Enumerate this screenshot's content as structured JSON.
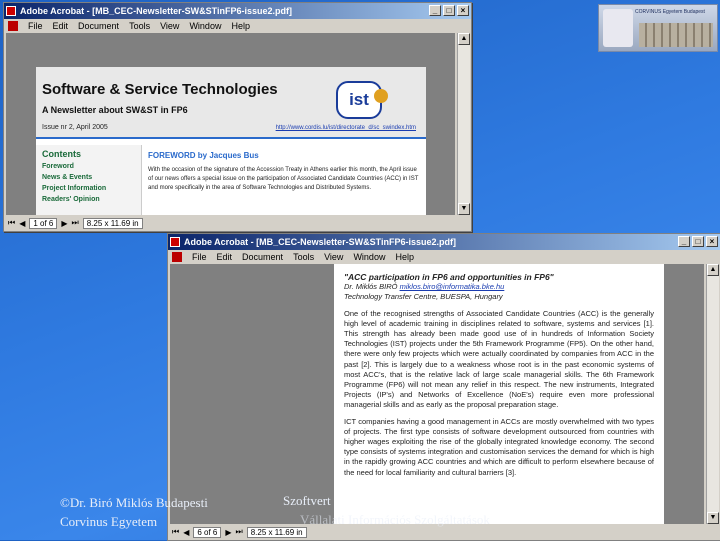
{
  "logo": {
    "text": "CORVINUS Egyetem Budapest",
    "alt": "Corvinus University Budapest logo with building"
  },
  "window1": {
    "title": "Adobe Acrobat - [MB_CEC-Newsletter-SW&STinFP6-issue2.pdf]",
    "menu": [
      "File",
      "Edit",
      "Document",
      "Tools",
      "View",
      "Window",
      "Help"
    ],
    "page_indicator": "1 of 6",
    "page_size": "8.25 x 11.69 in",
    "newsletter": {
      "title": "Software & Service Technologies",
      "subtitle": "A Newsletter about SW&ST in FP6",
      "issue": "Issue nr 2, April 2005",
      "url": "http://www.cordis.lu/ist/directorate_d/sc_swindex.htm",
      "logo_text": "ist",
      "contents_heading": "Contents",
      "contents_items": [
        "Foreword",
        "News & Events",
        "Project Information",
        "Readers' Opinion"
      ],
      "foreword_heading": "FOREWORD by Jacques Bus",
      "foreword_text": "With the occasion of the signature of the Accession Treaty in Athens earlier this month, the April issue of our news offers a special issue on the participation of Associated Candidate Countries (ACC) in IST and more specifically in the area of Software Technologies and Distributed Systems."
    }
  },
  "window2": {
    "title": "Adobe Acrobat - [MB_CEC-Newsletter-SW&STinFP6-issue2.pdf]",
    "menu": [
      "File",
      "Edit",
      "Document",
      "Tools",
      "View",
      "Window",
      "Help"
    ],
    "page_indicator": "6 of 6",
    "page_size": "8.25 x 11.69 in",
    "article": {
      "heading": "\"ACC participation in FP6 and opportunities in FP6\"",
      "author": "Dr. Miklós BIRÓ",
      "author_email": "miklos.biro@informatika.bke.hu",
      "org": "Technology Transfer Centre, BUESPA, Hungary",
      "para1": "One of the recognised strengths of Associated Candidate Countries (ACC) is the generally high level of academic training in disciplines related to software, systems and services [1]. This strength has already been made good use of in hundreds of Information Society Technologies (IST) projects under the 5th Framework Programme (FP5). On the other hand, there were only few projects which were actually coordinated by companies from ACC in the past [2]. This is largely due to a weakness whose root is in the past economic systems of most ACC's, that is the relative lack of large scale managerial skills. The 6th Framework Programme (FP6) will not mean any relief in this respect. The new instruments, Integrated Projects (IP's) and Networks of Excellence (NoE's) require even more professional managerial skills and as early as the proposal preparation stage.",
      "para2": "ICT companies having a good management in ACCs are mostly overwhelmed with two types of projects. The first type consists of software development outsourced from countries with higher wages exploiting the rise of the globally integrated knowledge economy. The second type consists of systems integration and customisation services the demand for which is high in the rapidly growing ACC countries and which are difficult to perform elsewhere because of the need for local familiarity and cultural barriers [3]."
    }
  },
  "footer": {
    "line1": "©Dr. Biró Miklós Budapesti",
    "line2": "Corvinus Egyetem",
    "mid1": "Szoftvert",
    "mid2": "Vállalati Információs Szolgáltatások"
  },
  "colors": {
    "background": "#2f7ae0",
    "titlebar": "#0a246a",
    "nl_accent": "#2a6acb",
    "contents_green": "#1a6a3a"
  }
}
